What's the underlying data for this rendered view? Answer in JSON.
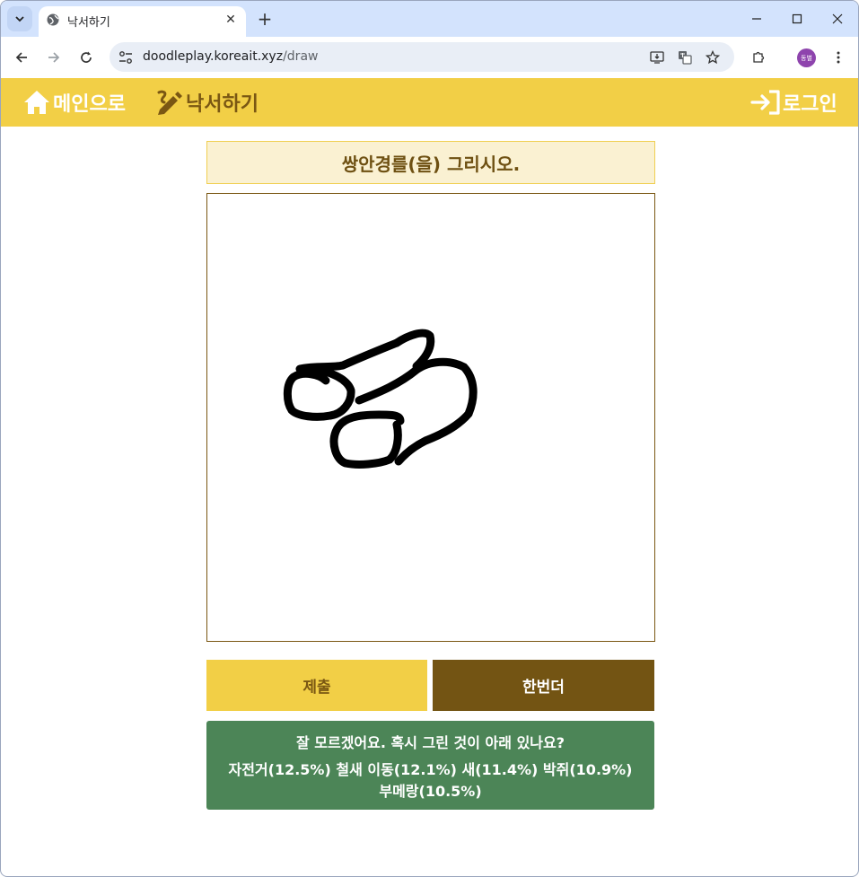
{
  "browser": {
    "tab_title": "낙서하기",
    "url_host": "doodleplay.koreait.xyz",
    "url_path": "/draw",
    "profile_label": "동별"
  },
  "nav": {
    "home_label": "메인으로",
    "doodle_label": "낙서하기",
    "login_label": "로그인"
  },
  "prompt": "쌍안경를(을) 그리시오.",
  "canvas": {
    "strokes": [
      "M361,422 C354,415 336,411 325,418 C316,426 317,446 323,455 C330,462 350,464 366,461 C380,459 390,446 389,433 C385,420 368,414 352,409",
      "M332,409 C350,405 368,408 380,405 C396,398 420,388 440,380",
      "M440,380 C452,372 470,365 477,372 C480,384 474,395 462,406",
      "M398,444 C415,437 440,428 462,410 C476,400 498,398 515,407 C527,420 528,440 520,459 C508,473 490,482 472,489 C458,496 448,505 442,512",
      "M444,467 C444,460 434,460 420,460 C400,460 378,462 372,479 C367,492 372,510 383,514 C397,517 420,515 432,510 C441,502 443,484 440,471"
    ]
  },
  "buttons": {
    "submit": "제출",
    "again": "한번더"
  },
  "result": {
    "question": "잘 모르겠어요. 혹시 그린 것이 아래 있나요?",
    "guesses": "자전거(12.5%) 철새 이동(12.1%) 새(11.4%) 박쥐(10.9%) 부메랑(10.5%)"
  },
  "colors": {
    "nav_bg": "#f2cf46",
    "brand_dark": "#7a5713",
    "result_bg": "#4c8557"
  }
}
